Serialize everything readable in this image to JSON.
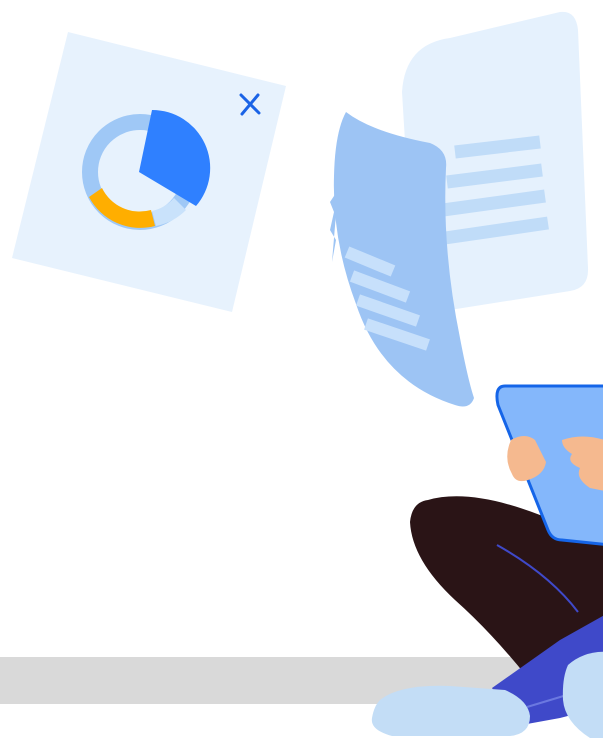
{
  "illustration": {
    "subject": "person-holding-tablet-with-floating-documents",
    "icons": {
      "chart_card": "donut-chart-icon",
      "close": "close-icon",
      "document_back": "document-icon",
      "document_front": "document-icon",
      "tablet": "tablet-icon"
    },
    "donut_chart": {
      "segments": [
        {
          "name": "blue",
          "fraction": 0.3,
          "color": "#2f80ff"
        },
        {
          "name": "light-blue",
          "fraction": 0.12,
          "color": "#c9e2fb"
        },
        {
          "name": "orange",
          "fraction": 0.22,
          "color": "#ffae00"
        },
        {
          "name": "pale-blue",
          "fraction": 0.36,
          "color": "#9fc8f6"
        }
      ]
    },
    "colors": {
      "card_bg": "#e7f2fd",
      "document_light": "#e5f1fd",
      "document_lines": "#c0dcf8",
      "document_front": "#9dc4f4",
      "tablet": "#84b7fb",
      "tablet_border": "#1565e8",
      "close_icon": "#1a63e6",
      "skin": "#f5b98f",
      "pants_dark": "#2a1416",
      "sleeve": "#3f49c9",
      "shoe": "#c3ddf6",
      "floor": "#d9d9d9"
    }
  }
}
